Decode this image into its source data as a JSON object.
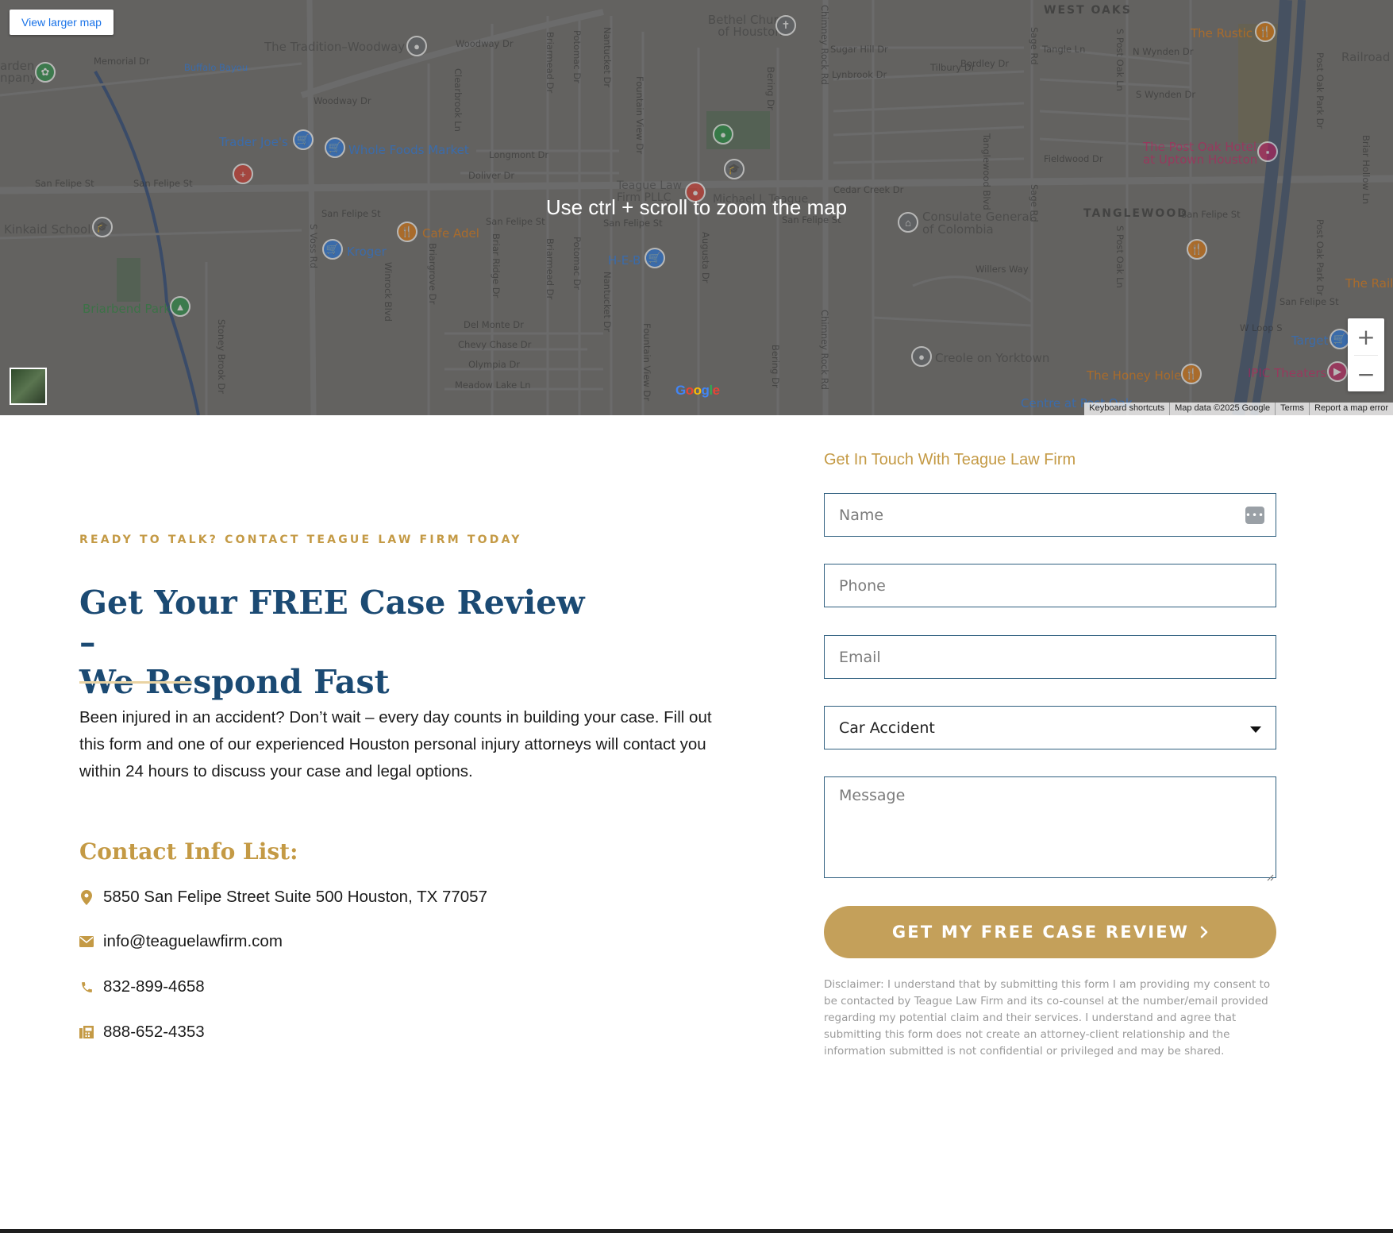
{
  "map": {
    "view_larger_label": "View larger map",
    "zoom_hint": "Use ctrl + scroll to zoom the map",
    "zoom_in_label": "+",
    "zoom_out_label": "−",
    "google_logo": "Google",
    "attribution": {
      "keyboard": "Keyboard shortcuts",
      "data": "Map data ©2025 Google",
      "terms": "Terms",
      "report": "Report a map error"
    },
    "places": {
      "tradition": "The Tradition–Woodway",
      "bethel": "Bethel Church of Houston",
      "west_oaks": "WEST OAKS",
      "rustic": "The Rustic",
      "railroad": "Railroad",
      "trader_joes": "Trader Joe's",
      "whole_foods": "Whole Foods Market",
      "post_oak_hotel": "The Post Oak Hotel at Uptown Houston",
      "kinkaid": "Kinkaid School",
      "cafe_adel": "Cafe Adel",
      "kroger": "Kroger",
      "heb": "H-E-B",
      "teague": "Teague Law Firm PLLC",
      "michael": "Michael L Teague",
      "consulate": "Consulate General of Colombia",
      "tanglewood": "TANGLEWOOD",
      "briarbend": "Briarbend Park",
      "creole": "Creole on Yorktown",
      "honey_hole": "The Honey Hole",
      "target": "Target",
      "ipic": "IPIC Theaters",
      "the_rail": "The Rail",
      "garden": "arden npany",
      "centre": "Centre at Post Oak"
    },
    "streets": {
      "san_felipe": "San Felipe St",
      "woodway": "Woodway Dr",
      "memorial": "Memorial Dr",
      "buffalo": "Buffalo Bayou",
      "longmont": "Longmont Dr",
      "doliver": "Doliver Dr",
      "s_voss": "S Voss Rd",
      "del_monte": "Del Monte Dr",
      "chevy_chase": "Chevy Chase Dr",
      "olympia": "Olympia Dr",
      "meadow_lake": "Meadow Lake Ln",
      "stoney_brook": "Stoney Brook Dr",
      "fountain_view": "Fountain View Dr",
      "chimney_rock": "Chimney Rock Rd",
      "sage": "Sage Rd",
      "post_oak": "S Post Oak Ln",
      "bering": "Bering Dr",
      "augusta": "Augusta Dr",
      "tangle": "Tangle Ln",
      "tilbury": "Tilbury Dr",
      "bordley": "Bordley Dr",
      "cedar_creek": "Cedar Creek Dr",
      "fieldwood": "Fieldwood Dr",
      "willers": "Willers Way",
      "sugar_hill": "Sugar Hill Dr",
      "lynbrook": "Lynbrook Dr",
      "briarmead": "Briarmead Dr",
      "potomac": "Potomac Dr",
      "nantucket": "Nantucket Dr",
      "winrock": "Winrock Blvd",
      "briargrove": "Briargrove Dr",
      "briar_ridge": "Briar Ridge Dr",
      "clearbrook": "Clearbrook Ln",
      "tanglewood_blvd": "Tanglewood Blvd",
      "n_wynden": "N Wynden Dr",
      "s_wynden": "S Wynden Dr",
      "post_oak_park": "Post Oak Park Dr",
      "briar_hollow": "Briar Hollow Ln",
      "loop": "W Loop S"
    }
  },
  "intro": {
    "eyebrow": "READY TO TALK? CONTACT TEAGUE LAW FIRM TODAY",
    "headline_line1": "Get Your FREE Case Review –",
    "headline_line2": "We Respond Fast",
    "body": "Been injured in an accident? Don’t wait – every day counts in building your case. Fill out this form and one of our experienced Houston personal injury attorneys will contact you within 24 hours to discuss your case and legal options."
  },
  "contact": {
    "title": "Contact Info List:",
    "address": "5850 San Felipe Street Suite 500 Houston, TX 77057",
    "email": "info@teaguelawfirm.com",
    "phone": "832-899-4658",
    "fax": "888-652-4353",
    "icons": [
      "map-pin-icon",
      "envelope-icon",
      "phone-icon",
      "fax-icon"
    ],
    "icon_color": "#c49a45"
  },
  "form": {
    "title": "Get In Touch With Teague Law Firm",
    "name_placeholder": "Name",
    "phone_placeholder": "Phone",
    "email_placeholder": "Email",
    "case_type_selected": "Car Accident",
    "message_placeholder": "Message",
    "submit_label": "GET MY FREE CASE REVIEW",
    "disclaimer": "Disclaimer: I understand that by submitting this form I am providing my consent to be contacted by Teague Law Firm and its co-counsel at the number/email provided regarding my potential claim and their services. I understand and agree that submitting this form does not create an attorney-client relationship and the information submitted is not confidential or privileged and may be shared."
  },
  "colors": {
    "gold": "#c49a45",
    "button_gold": "#c4a05a",
    "navy": "#1b4a73",
    "field_border": "#2f5f7f"
  }
}
